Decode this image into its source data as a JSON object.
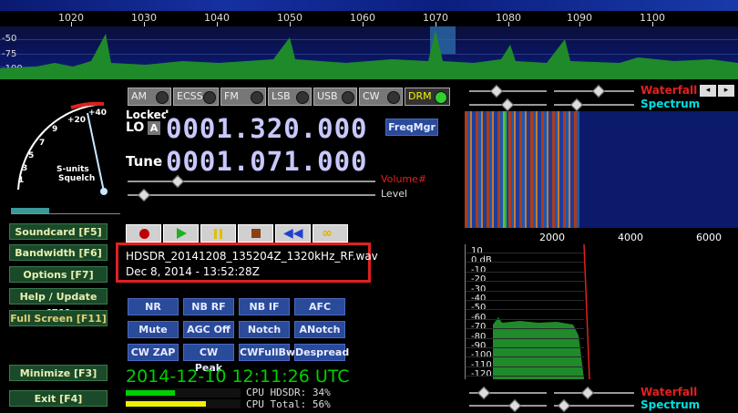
{
  "top_scale": {
    "labels": [
      "1020",
      "1030",
      "1040",
      "1050",
      "1060",
      "1070",
      "1080",
      "1090",
      "1100"
    ]
  },
  "db_labels": [
    "-50",
    "-75",
    "-100"
  ],
  "smeter": {
    "scale_labels": [
      "+40",
      "+20",
      "9",
      "7",
      "5",
      "3",
      "1"
    ],
    "label": "S-units\nSquelch",
    "s_units": "S-units",
    "squelch": "Squelch"
  },
  "left_buttons": [
    {
      "label": "Soundcard  [F5]"
    },
    {
      "label": "Bandwidth  [F6]"
    },
    {
      "label": "Options  [F7]"
    },
    {
      "label": "Help / Update  [F1]"
    },
    {
      "label": "Full Screen  [F11]"
    },
    {
      "label": "Minimize  [F3]"
    },
    {
      "label": "Exit     [F4]"
    }
  ],
  "modes": [
    {
      "label": "AM"
    },
    {
      "label": "ECSS"
    },
    {
      "label": "FM"
    },
    {
      "label": "LSB"
    },
    {
      "label": "USB"
    },
    {
      "label": "CW"
    },
    {
      "label": "DRM",
      "active": true
    }
  ],
  "lo": {
    "locked_label": "Locked",
    "lo_label": "LO",
    "a_label": "A",
    "value": "0001.320.000"
  },
  "tune": {
    "label": "Tune",
    "value": "0001.071.000"
  },
  "freqmgr_label": "FreqMgr",
  "volume_label": "Volume#",
  "level_label": "Level",
  "file": {
    "name": "HDSDR_20141208_135204Z_1320kHz_RF.wav",
    "date": "Dec 8, 2014 - 13:52:28Z"
  },
  "dsp_buttons": [
    [
      "NR",
      "NB RF",
      "NB IF",
      "AFC"
    ],
    [
      "Mute",
      "AGC Off",
      "Notch",
      "ANotch"
    ],
    [
      "CW ZAP",
      "CW Peak",
      "CWFullBw",
      "Despread"
    ]
  ],
  "clock": "2014-12-10  12:11:26 UTC",
  "cpu": {
    "hdsdr": "CPU HDSDR: 34%",
    "total": "CPU Total: 56%",
    "hdsdr_frac": 0.34,
    "total_frac": 0.56
  },
  "right": {
    "waterfall": "Waterfall",
    "spectrum": "Spectrum",
    "freq_labels": [
      "2000",
      "4000",
      "6000"
    ],
    "db_labels": [
      "10",
      "0 dB",
      "-10",
      "-20",
      "-30",
      "-40",
      "-50",
      "-60",
      "-70",
      "-80",
      "-90",
      "-100",
      "-110",
      "-120"
    ]
  },
  "colors": {
    "waterfall": "#e02020",
    "spectrum": "#00e0e0",
    "clock": "#00d000"
  }
}
